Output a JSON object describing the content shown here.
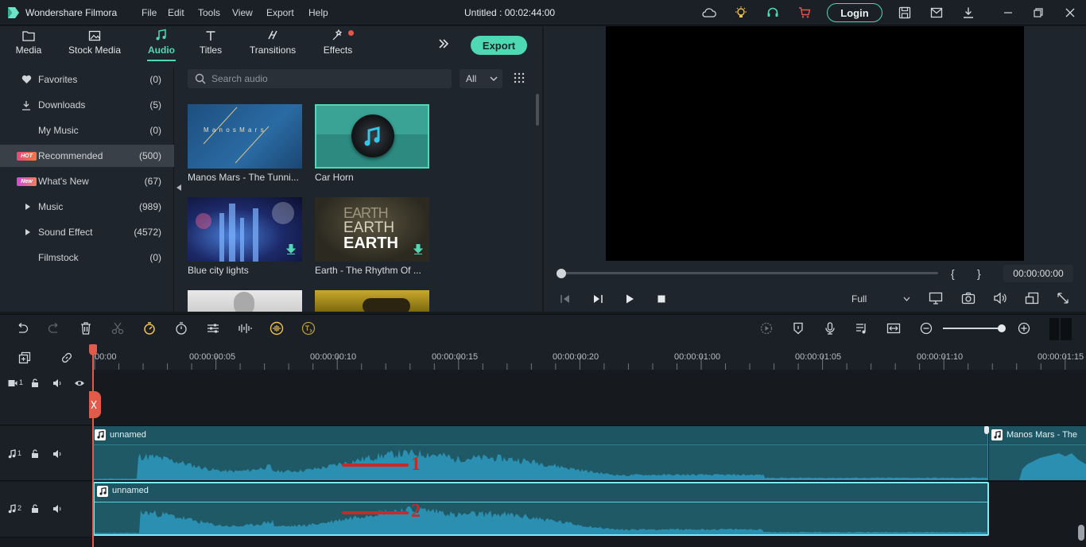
{
  "app": {
    "name": "Wondershare Filmora",
    "document_title": "Untitled : 00:02:44:00",
    "login_label": "Login"
  },
  "menu": [
    "File",
    "Edit",
    "Tools",
    "View",
    "Export",
    "Help"
  ],
  "tabs": [
    {
      "label": "Media",
      "icon": "folder-icon"
    },
    {
      "label": "Stock Media",
      "icon": "image-icon"
    },
    {
      "label": "Audio",
      "icon": "music-note-icon",
      "active": true
    },
    {
      "label": "Titles",
      "icon": "text-icon"
    },
    {
      "label": "Transitions",
      "icon": "transitions-icon"
    },
    {
      "label": "Effects",
      "icon": "effects-icon",
      "dot": true
    }
  ],
  "export_label": "Export",
  "sidebar": {
    "items": [
      {
        "label": "Favorites",
        "count": "(0)",
        "icon": "heart-icon"
      },
      {
        "label": "Downloads",
        "count": "(5)",
        "icon": "download-icon"
      },
      {
        "label": "My Music",
        "count": "(0)"
      },
      {
        "label": "Recommended",
        "count": "(500)",
        "badge": "HOT",
        "selected": true
      },
      {
        "label": "What's New",
        "count": "(67)",
        "badge": "New"
      },
      {
        "label": "Music",
        "count": "(989)",
        "expand": true
      },
      {
        "label": "Sound Effect",
        "count": "(4572)",
        "expand": true
      },
      {
        "label": "Filmstock",
        "count": "(0)"
      }
    ]
  },
  "search": {
    "placeholder": "Search audio",
    "filter_value": "All"
  },
  "library": {
    "items": [
      {
        "title": "Manos Mars - The Tunni...",
        "thumb_text": "M a n o s   M a r s"
      },
      {
        "title": "Car Horn",
        "selected": true
      },
      {
        "title": "Blue city lights"
      },
      {
        "title": "Earth - The Rhythm Of ...",
        "thumb_text": [
          "EARTH",
          "EARTH",
          "EARTH"
        ]
      }
    ]
  },
  "preview": {
    "brace_open": "{",
    "brace_close": "}",
    "timecode": "00:00:00:00",
    "quality": "Full"
  },
  "ruler": [
    "00:00",
    "00:00:00:05",
    "00:00:00:10",
    "00:00:00:15",
    "00:00:00:20",
    "00:00:01:00",
    "00:00:01:05",
    "00:00:01:10",
    "00:00:01:15"
  ],
  "tracks": {
    "video1_label": "1",
    "audio1_label": "1",
    "audio2_label": "2",
    "audio1_clips": [
      "unnamed",
      "Manos Mars - The"
    ],
    "audio2_clip": "unnamed"
  },
  "annotations": [
    "1",
    "2"
  ],
  "colors": {
    "accent": "#4fd8b4",
    "clip": "#1f5966",
    "waveform": "#2a8fb0",
    "playhead": "#e25b4a",
    "annotation": "#c42b2b"
  }
}
